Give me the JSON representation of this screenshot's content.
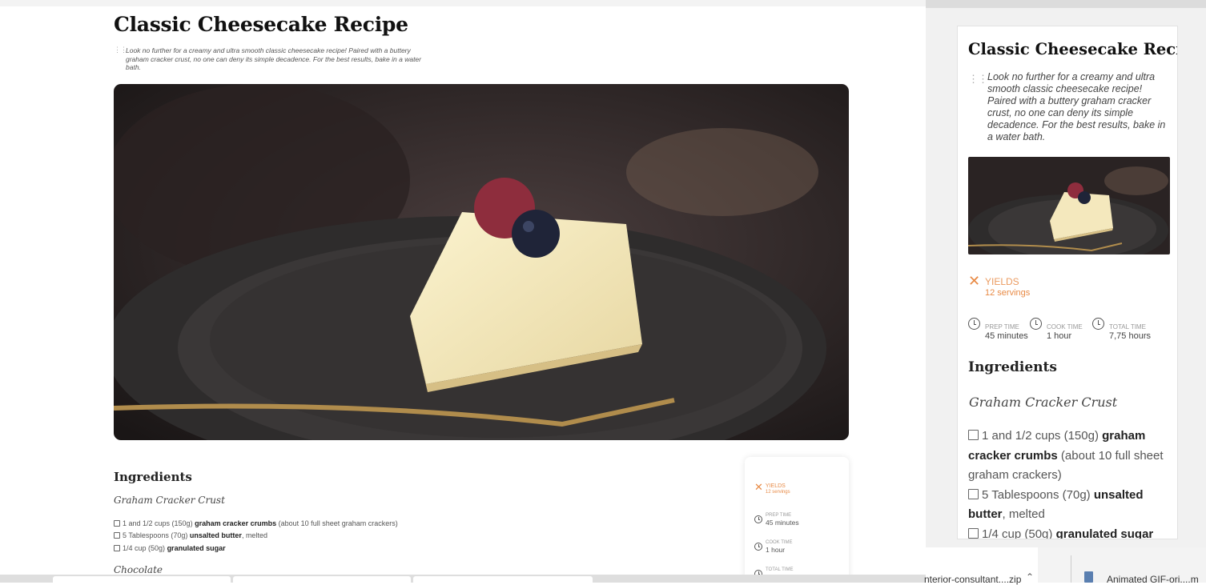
{
  "recipe": {
    "title": "Classic Cheesecake Recipe",
    "description": "Look no further for a creamy and ultra smooth classic cheesecake recipe! Paired with a buttery graham cracker crust, no one can deny its simple decadence. For the best results, bake in a water bath.",
    "yields": {
      "label": "YIELDS",
      "value": "12 servings"
    },
    "times": [
      {
        "label": "PREP TIME",
        "value": "45 minutes"
      },
      {
        "label": "COOK TIME",
        "value": "1 hour"
      },
      {
        "label": "TOTAL TIME",
        "value": "7,75 hours"
      }
    ],
    "ingredients_heading": "Ingredients",
    "section_crust": "Graham Cracker Crust",
    "section_chocolate": "Chocolate",
    "ingredients": [
      {
        "amount": "1 and 1/2 cups (150g)",
        "name": "graham cracker crumbs",
        "note": "(about 10 full sheet graham crackers)"
      },
      {
        "amount": "5 Tablespoons (70g)",
        "name": "unsalted butter",
        "note": ", melted"
      },
      {
        "amount": "1/4 cup (50g)",
        "name": "granulated sugar",
        "note": ""
      }
    ]
  },
  "downloads": {
    "items": [
      "nterior-consultant....zip",
      "Animated GIF-ori....m"
    ]
  },
  "colors": {
    "accent": "#e88a45",
    "page_bg": "#ffffff",
    "panel_bg": "#f1f1f1"
  },
  "icons": {
    "yields": "utensils-icon",
    "time": "clock-icon",
    "drag": "drag-handle-icon",
    "expand": "chevron-up-icon",
    "file": "file-icon"
  }
}
